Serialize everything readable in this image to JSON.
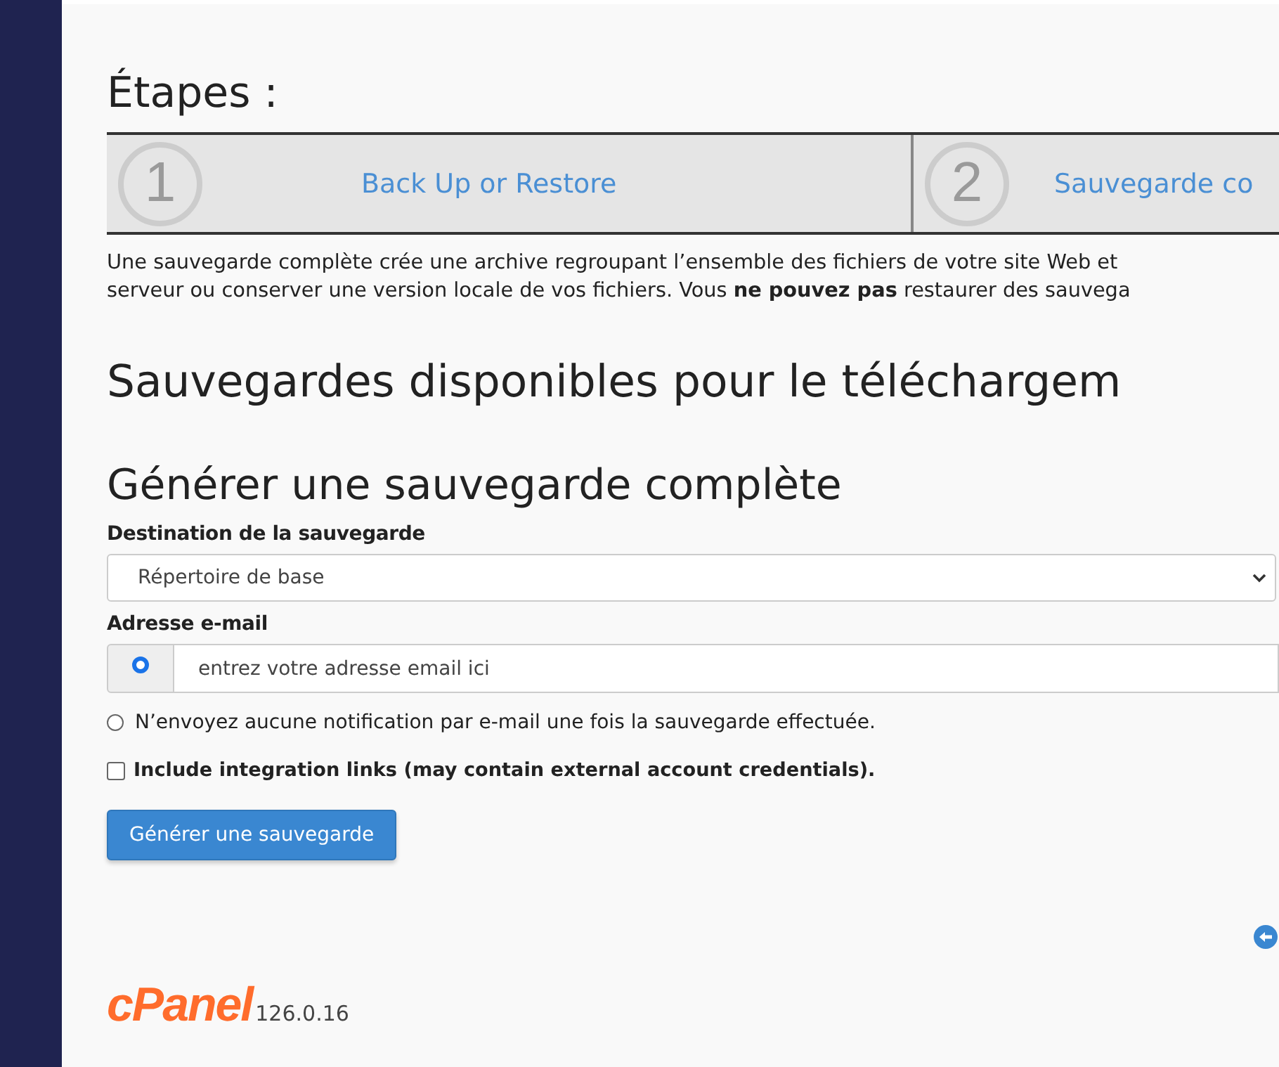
{
  "heading": "Étapes :",
  "steps": [
    {
      "number": "1",
      "label": "Back Up or Restore"
    },
    {
      "number": "2",
      "label": "Sauvegarde co"
    }
  ],
  "intro": "Une sauvegarde complète crée une archive regroupant l’ensemble des fichiers de votre site Web et\nserveur ou conserver une version locale de vos fichiers. Vous **ne pouvez pas** restaurer des sauvega",
  "downloads_heading": "Sauvegardes disponibles pour le téléchargem",
  "generate_heading": "Générer une sauvegarde complète",
  "destination": {
    "label": "Destination de la sauvegarde",
    "value": "Répertoire de base"
  },
  "email": {
    "label": "Adresse e-mail",
    "placeholder": "entrez votre adresse email ici",
    "selected": true
  },
  "no_notify": {
    "label": "N’envoyez aucune notification par e-mail une fois la sauvegarde effectuée.",
    "selected": false
  },
  "include_links": {
    "label": "Include integration links (may contain external account credentials).",
    "checked": false
  },
  "button": "Générer une sauvegarde",
  "footer": {
    "logo": "cPanel",
    "version": "126.0.16"
  }
}
